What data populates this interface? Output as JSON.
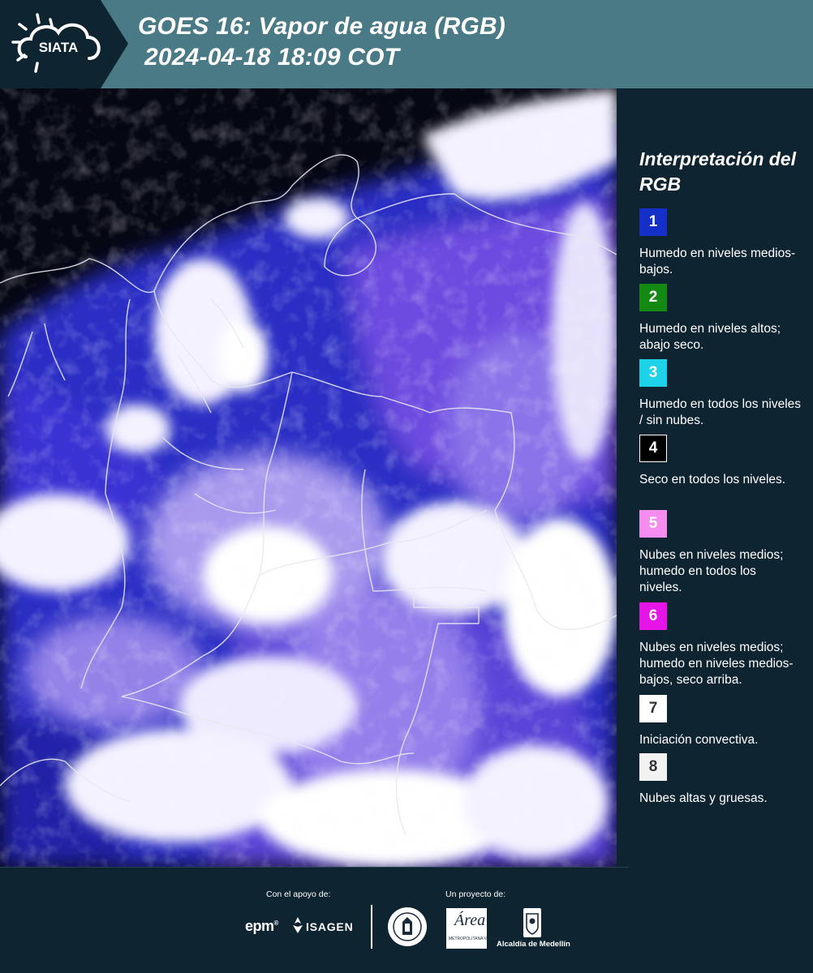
{
  "header": {
    "logo_text": "SIATA",
    "title_line1": "GOES 16: Vapor de agua (RGB)",
    "title_line2": "2024-04-18 18:09 COT"
  },
  "legend": {
    "title": "Interpretación del RGB",
    "items": [
      {
        "number": "1",
        "color": "#1530c8",
        "text": "Humedo en niveles medios-bajos."
      },
      {
        "number": "2",
        "color": "#148a14",
        "text": "Humedo en niveles altos; abajo seco."
      },
      {
        "number": "3",
        "color": "#1ed2ea",
        "text": "Humedo en todos los niveles / sin nubes."
      },
      {
        "number": "4",
        "color": "#000000",
        "text": "Seco en todos los niveles."
      },
      {
        "number": "5",
        "color": "#f58cf0",
        "text": "Nubes en niveles medios; humedo en todos los niveles."
      },
      {
        "number": "6",
        "color": "#e614e6",
        "text": "Nubes en niveles medios; humedo en niveles medios-bajos, seco arriba."
      },
      {
        "number": "7",
        "color": "#ffffff",
        "text": "Iniciación convectiva."
      },
      {
        "number": "8",
        "color": "#f2f2f2",
        "text": "Nubes altas y gruesas."
      }
    ]
  },
  "footer": {
    "support_label": "Con el apoyo de:",
    "project_label": "Un proyecto de:",
    "sponsors": [
      "epm",
      "ISAGEN"
    ],
    "partners": [
      "Área",
      "METROPOLITANA Valle de Aburrá",
      "Alcaldía de Medellín"
    ]
  },
  "map": {
    "colors": {
      "dry_black": "#050712",
      "moist_blue": "#2b2fc4",
      "mid_purple": "#6d4be0",
      "lavender": "#b7a6f3",
      "cloud_white": "#f4f2ff",
      "border_line": "#e8e8f0"
    }
  }
}
